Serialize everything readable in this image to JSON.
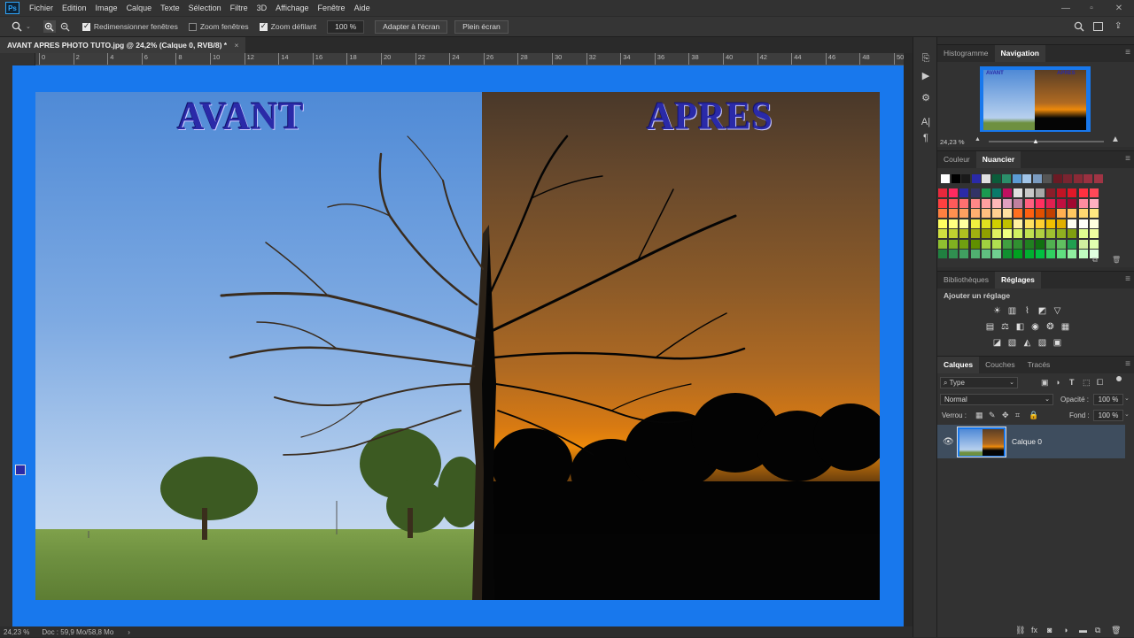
{
  "app": {
    "logo": "Ps"
  },
  "menu": [
    "Fichier",
    "Edition",
    "Image",
    "Calque",
    "Texte",
    "Sélection",
    "Filtre",
    "3D",
    "Affichage",
    "Fenêtre",
    "Aide"
  ],
  "window_controls": [
    "—",
    "▫",
    "✕"
  ],
  "options_bar": {
    "resize_windows": {
      "label": "Redimensionner fenêtres",
      "checked": true
    },
    "zoom_all": {
      "label": "Zoom fenêtres",
      "checked": false
    },
    "scrubby_zoom": {
      "label": "Zoom défilant",
      "checked": true
    },
    "zoom_value": "100 %",
    "fit_screen_label": "Adapter à l'écran",
    "fill_screen_label": "Plein écran"
  },
  "document_tab": {
    "title": "AVANT APRES PHOTO TUTO.jpg @ 24,2% (Calque 0, RVB/8) *",
    "close": "×"
  },
  "ruler": {
    "top_ticks": [
      "0",
      "2",
      "4",
      "6",
      "8",
      "10",
      "12",
      "14",
      "16",
      "18",
      "20",
      "22",
      "24",
      "26",
      "28",
      "30",
      "32",
      "34",
      "36",
      "38",
      "40",
      "42",
      "44",
      "46",
      "48",
      "50"
    ],
    "left_ticks": [
      "0",
      "2",
      "4",
      "6",
      "8",
      "1\n0",
      "1\n2",
      "1\n4",
      "1\n6",
      "1\n8",
      "2\n0",
      "2\n2",
      "2\n4",
      "2\n6",
      "2\n8",
      "3\n0"
    ]
  },
  "canvas": {
    "background_color": "#1878ed",
    "label_before": "AVANT",
    "label_after": "APRES"
  },
  "status": {
    "zoom": "24,23 %",
    "doc": "Doc : 59,9 Mo/58,8 Mo",
    "arrow": "›"
  },
  "panels": {
    "navigation": {
      "tabs": [
        "Histogramme",
        "Navigation"
      ],
      "active": "Navigation",
      "zoom": "24,23 %"
    },
    "swatches": {
      "tabs": [
        "Couleur",
        "Nuancier"
      ],
      "active": "Nuancier"
    },
    "adjustments": {
      "tabs": [
        "Bibliothèques",
        "Réglages"
      ],
      "active": "Réglages",
      "heading": "Ajouter un réglage"
    },
    "layers": {
      "tabs": [
        "Calques",
        "Couches",
        "Tracés"
      ],
      "active": "Calques",
      "filter_type": "Type",
      "blend_mode": "Normal",
      "opacity_label": "Opacité :",
      "opacity_value": "100 %",
      "lock_label": "Verrou :",
      "fill_label": "Fond :",
      "fill_value": "100 %",
      "layer_name": "Calque 0"
    }
  },
  "colors": {
    "accent": "#2fa3f7",
    "canvas_blue": "#1878ed",
    "layer_selected": "#3e4d5e"
  }
}
